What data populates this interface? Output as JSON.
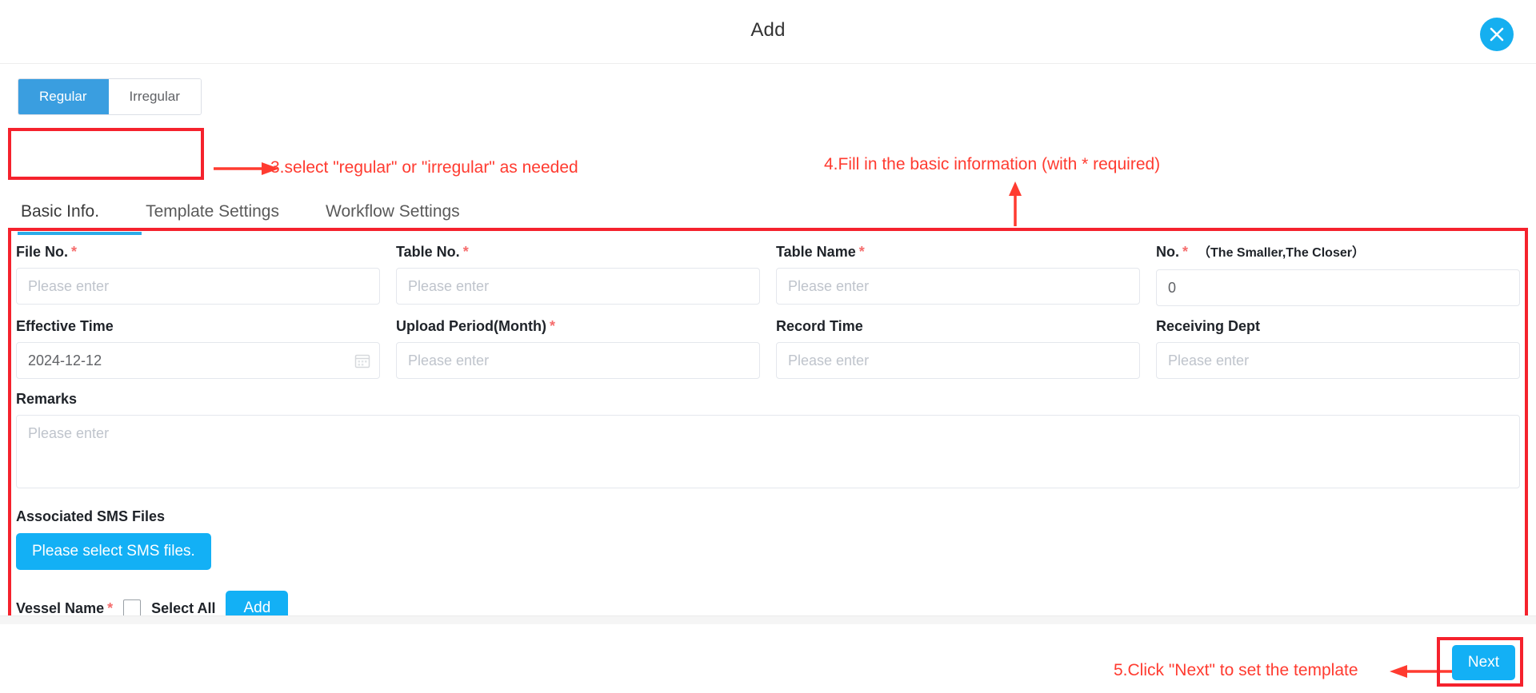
{
  "header": {
    "title": "Add",
    "close_icon": "close-icon"
  },
  "segmented": {
    "options": [
      {
        "label": "Regular",
        "active": true
      },
      {
        "label": "Irregular",
        "active": false
      }
    ]
  },
  "annotations": {
    "step3": "3.select \"regular\" or \"irregular\" as needed",
    "step4": "4.Fill in the basic information (with * required)",
    "step5": "5.Click \"Next\" to set the template",
    "color": "#ff3b30"
  },
  "tabs": [
    {
      "label": "Basic Info.",
      "active": true
    },
    {
      "label": "Template Settings",
      "active": false
    },
    {
      "label": "Workflow Settings",
      "active": false
    }
  ],
  "form": {
    "placeholder": "Please enter",
    "fields": {
      "file_no": {
        "label": "File No.",
        "required": "*",
        "value": "",
        "placeholder": "Please enter"
      },
      "table_no": {
        "label": "Table No.",
        "required": "*",
        "value": "",
        "placeholder": "Please enter"
      },
      "table_name": {
        "label": "Table Name",
        "required": "*",
        "value": "",
        "placeholder": "Please enter"
      },
      "no": {
        "label": "No.",
        "required": "*",
        "hint": "（The Smaller,The Closer）",
        "value": "0",
        "placeholder": ""
      },
      "effective_time": {
        "label": "Effective Time",
        "required": "",
        "value": "2024-12-12",
        "placeholder": "",
        "icon": "calendar-icon"
      },
      "upload_period": {
        "label": "Upload Period(Month)",
        "required": "*",
        "value": "",
        "placeholder": "Please enter"
      },
      "record_time": {
        "label": "Record Time",
        "required": "",
        "value": "",
        "placeholder": "Please enter"
      },
      "receiving_dept": {
        "label": "Receiving Dept",
        "required": "",
        "value": "",
        "placeholder": "Please enter"
      },
      "remarks": {
        "label": "Remarks",
        "required": "",
        "value": "",
        "placeholder": "Please enter"
      }
    },
    "sms": {
      "label": "Associated SMS Files",
      "button": "Please select SMS files."
    },
    "vessel": {
      "label": "Vessel Name",
      "required": "*",
      "select_all": "Select All",
      "add_button": "Add",
      "checked": false
    }
  },
  "footer": {
    "next_label": "Next"
  },
  "colors": {
    "accent": "#13b0f5",
    "segment_active": "#3a9ee0",
    "tab_underline": "#2aabe8",
    "required": "#f56c6c",
    "highlight": "#f5222d"
  }
}
